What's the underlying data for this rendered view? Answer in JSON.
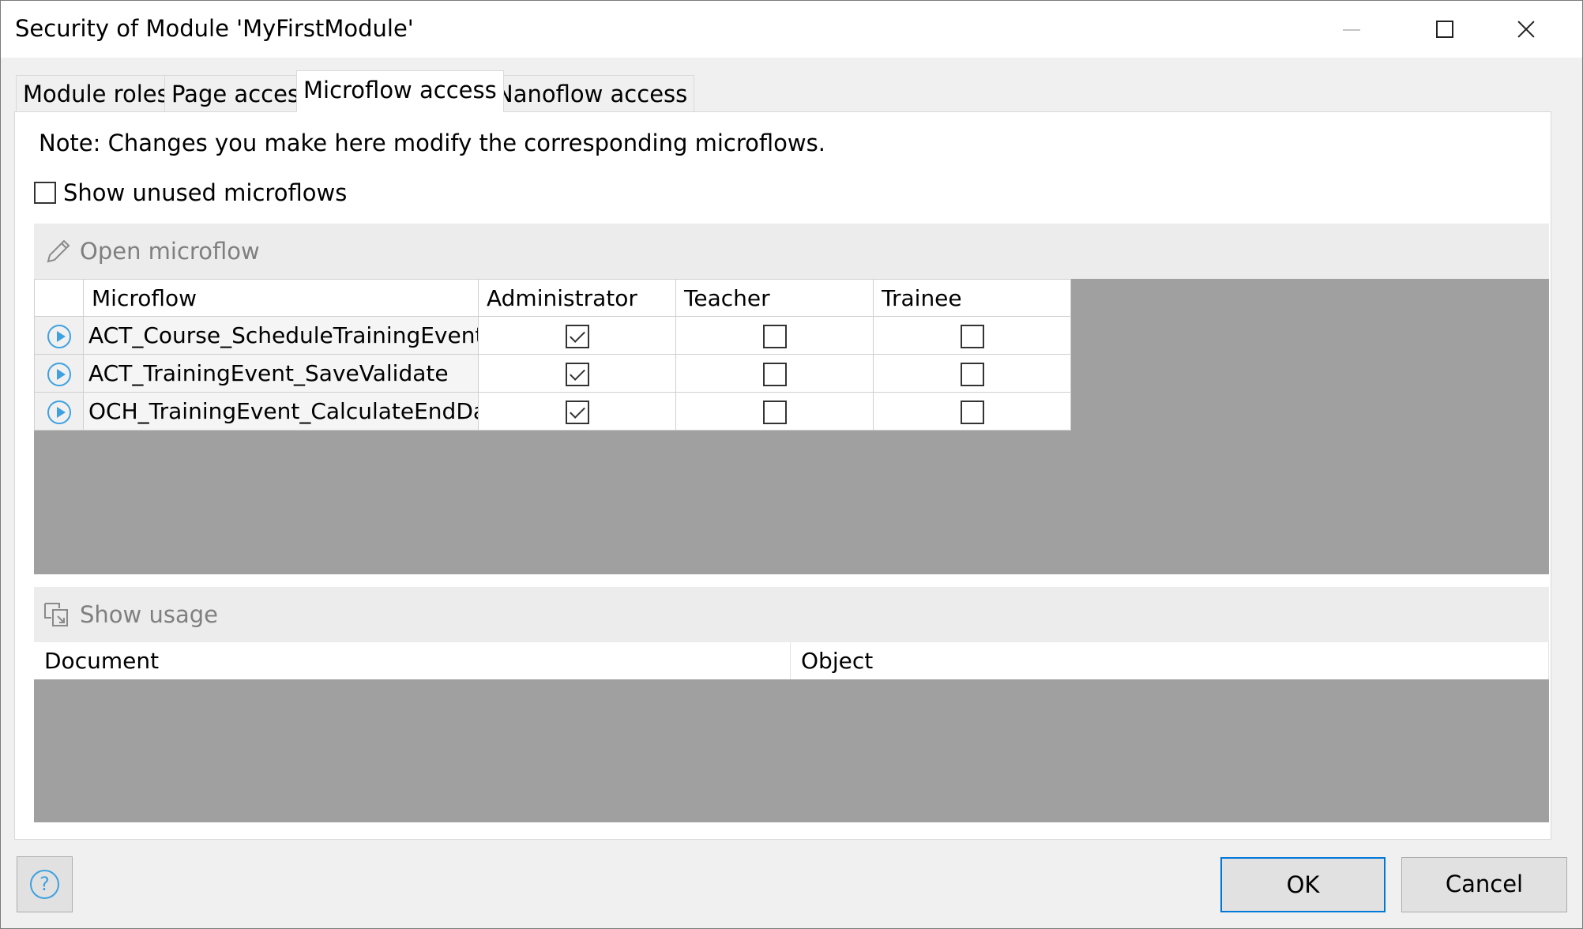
{
  "window": {
    "title": "Security of Module 'MyFirstModule'",
    "controls": [
      "minimize-icon",
      "maximize-icon",
      "close-icon"
    ]
  },
  "tabs": [
    {
      "label": "Module roles",
      "active": false
    },
    {
      "label": "Page access",
      "active": false
    },
    {
      "label": "Microflow access",
      "active": true
    },
    {
      "label": "Nanoflow access",
      "active": false
    }
  ],
  "note": "Note: Changes you make here modify the corresponding microflows.",
  "show_unused": {
    "label": "Show unused microflows",
    "checked": false
  },
  "toolbar": {
    "open_label": "Open microflow",
    "open_icon": "pencil-icon"
  },
  "grid": {
    "columns": [
      "Microflow",
      "Administrator",
      "Teacher",
      "Trainee"
    ],
    "rows": [
      {
        "name": "ACT_Course_ScheduleTrainingEvent",
        "access": [
          true,
          false,
          false
        ]
      },
      {
        "name": "ACT_TrainingEvent_SaveValidate",
        "access": [
          true,
          false,
          false
        ]
      },
      {
        "name": "OCH_TrainingEvent_CalculateEndDate",
        "access": [
          true,
          false,
          false
        ]
      }
    ]
  },
  "usage": {
    "show_label": "Show usage",
    "show_icon": "usage-icon",
    "columns": [
      "Document",
      "Object"
    ]
  },
  "buttons": {
    "ok": "OK",
    "cancel": "Cancel",
    "help": "?"
  },
  "colors": {
    "accent": "#0078d7",
    "icon_blue": "#3ea1e0",
    "empty_grid": "#a0a0a0"
  }
}
